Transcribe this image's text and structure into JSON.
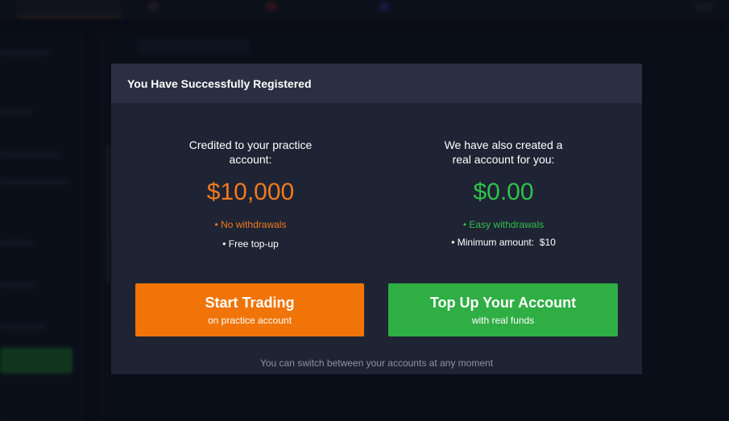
{
  "modal": {
    "title": "You Have Successfully Registered",
    "practice": {
      "caption_line1": "Credited to your practice",
      "caption_line2": "account:",
      "amount": "$10,000",
      "feature1": "• No withdrawals",
      "feature2": "• Free top-up"
    },
    "real": {
      "caption_line1": "We have also created a",
      "caption_line2": "real account for you:",
      "amount": "$0.00",
      "feature1": "• Easy withdrawals",
      "feature2": "• Minimum amount:  $10"
    },
    "start_button": {
      "label": "Start Trading",
      "sublabel": "on practice account"
    },
    "topup_button": {
      "label": "Top Up Your Account",
      "sublabel": "with real funds"
    },
    "footer_note": "You can switch between your accounts at any moment"
  },
  "colors": {
    "accent_orange": "#f07407",
    "accent_green": "#2fae44",
    "modal_bg": "#1f2434",
    "header_bg": "#2a3042"
  }
}
